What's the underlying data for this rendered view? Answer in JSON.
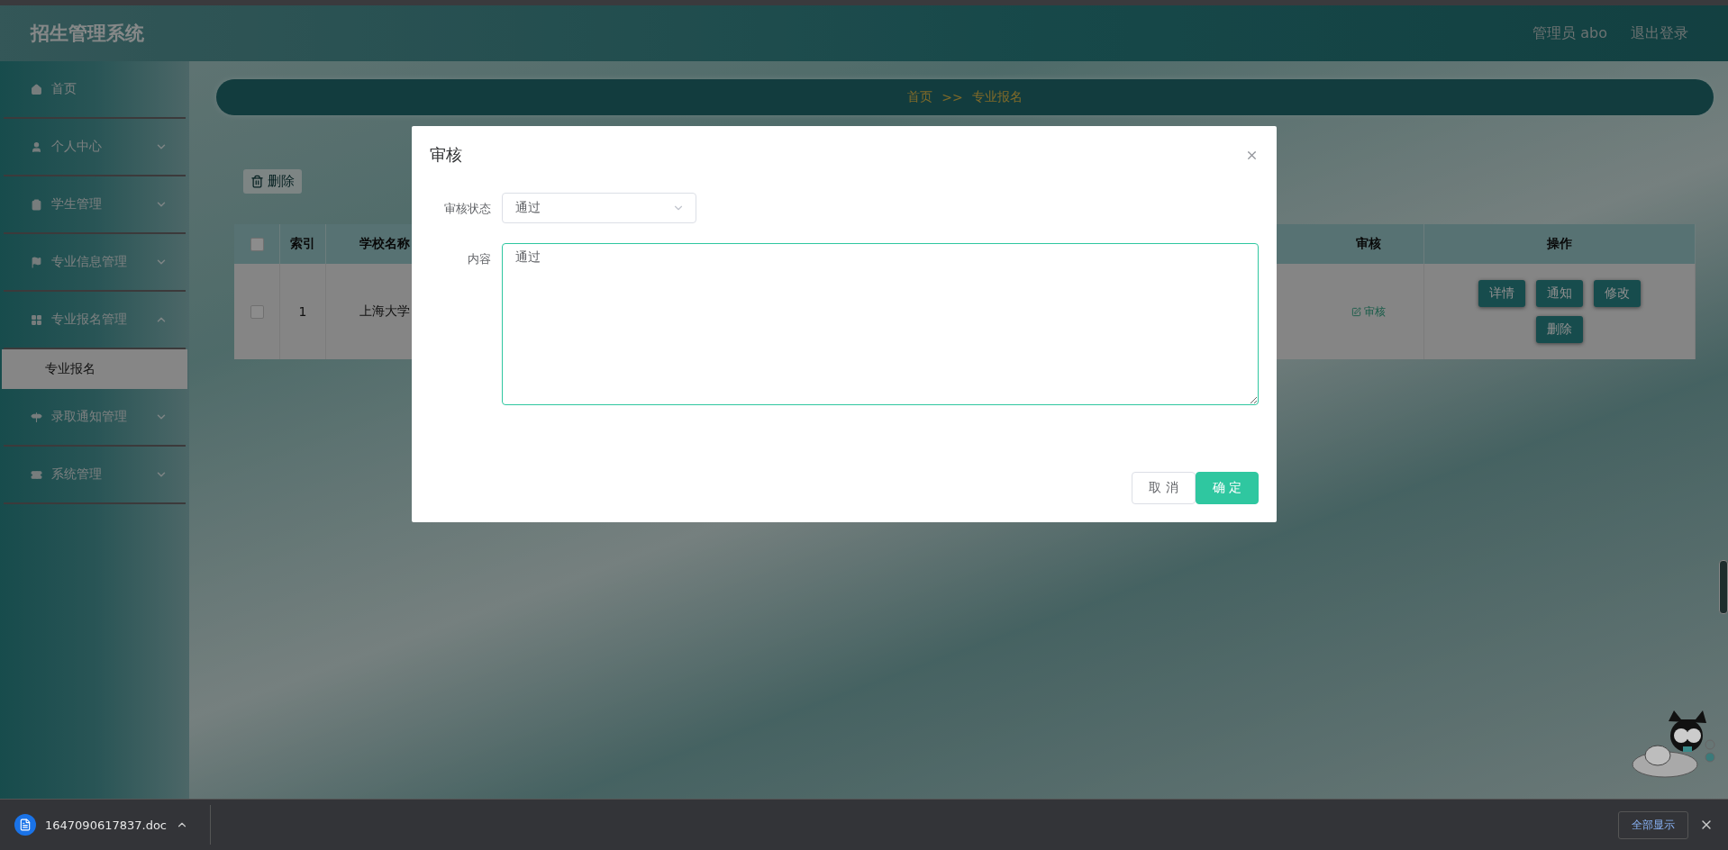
{
  "header": {
    "title": "招生管理系统",
    "user": "管理员 abo",
    "logout": "退出登录"
  },
  "sidebar": {
    "items": [
      {
        "label": "首页",
        "kind": "link"
      },
      {
        "label": "个人中心",
        "kind": "menu"
      },
      {
        "label": "学生管理",
        "kind": "menu"
      },
      {
        "label": "专业信息管理",
        "kind": "menu"
      },
      {
        "label": "专业报名管理",
        "kind": "menu",
        "expanded": true,
        "children": [
          {
            "label": "专业报名",
            "selected": true
          }
        ]
      },
      {
        "label": "录取通知管理",
        "kind": "menu"
      },
      {
        "label": "系统管理",
        "kind": "menu"
      }
    ]
  },
  "breadcrumb": {
    "items": [
      "首页",
      "专业报名"
    ],
    "separator": ">>"
  },
  "toolbar": {
    "delete_button": "删除"
  },
  "table": {
    "header_checked": false,
    "columns": [
      "索引",
      "学校名称",
      "审核",
      "操作"
    ],
    "rows": [
      {
        "checked": false,
        "cells": [
          "1",
          "上海大学"
        ],
        "review_link": "审核",
        "actions": [
          "详情",
          "通知",
          "修改",
          "删除"
        ]
      }
    ]
  },
  "dialog": {
    "title": "审核",
    "fields": [
      {
        "kind": "select",
        "label": "审核状态",
        "value": "通过"
      },
      {
        "kind": "textarea",
        "label": "内容",
        "value": "通过",
        "focused": true
      }
    ],
    "buttons": [
      {
        "label": "取 消",
        "kind": "default"
      },
      {
        "label": "确 定",
        "kind": "primary"
      }
    ]
  },
  "downloads": {
    "file": "1647090617837.doc",
    "show_all": "全部显示"
  }
}
